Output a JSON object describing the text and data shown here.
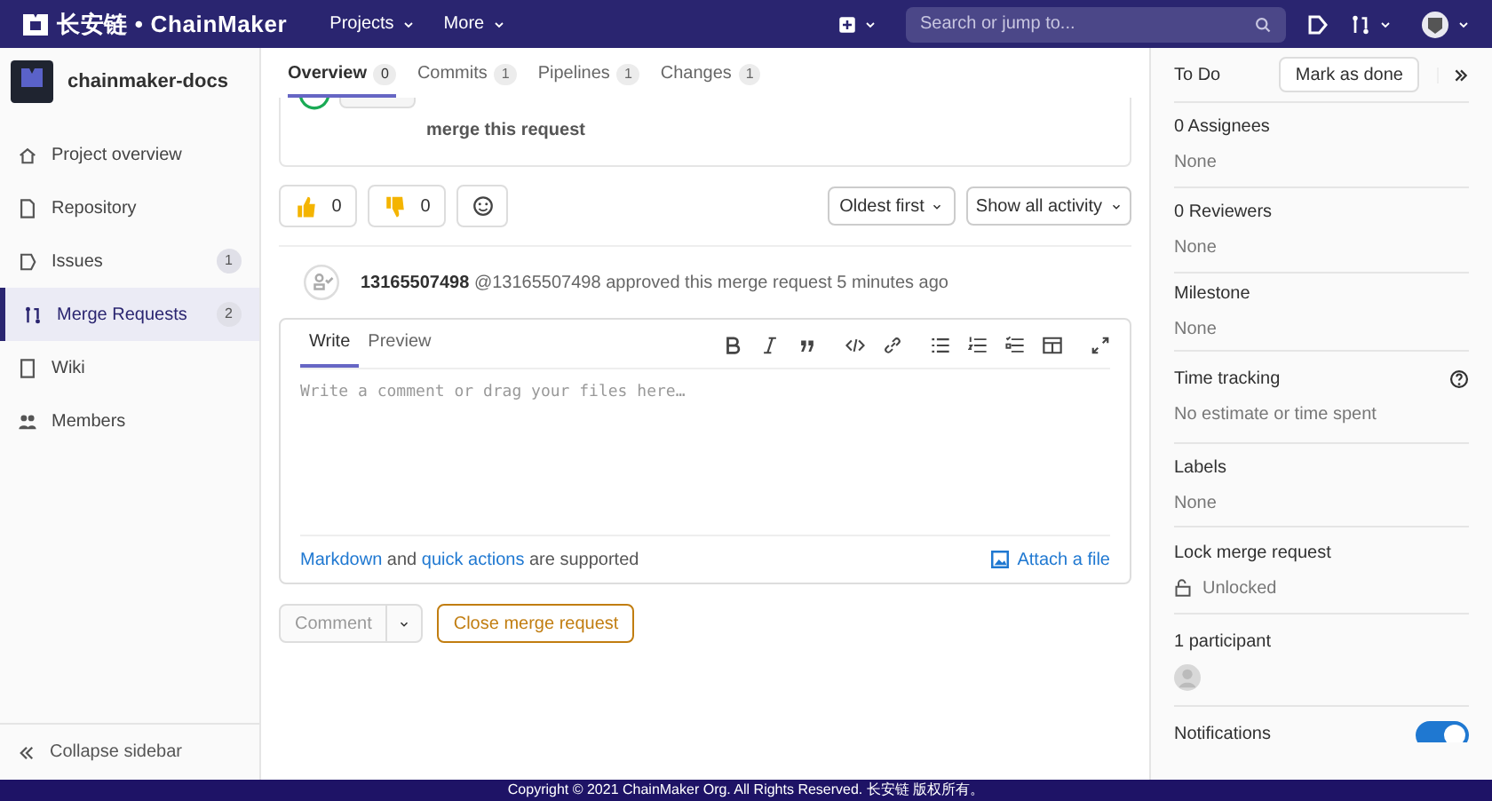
{
  "navbar": {
    "brand": "长安链 • ChainMaker",
    "menus": [
      {
        "label": "Projects"
      },
      {
        "label": "More"
      }
    ],
    "search": {
      "placeholder": "Search or jump to..."
    }
  },
  "sidebar": {
    "project": "chainmaker-docs",
    "items": [
      {
        "label": "Project overview",
        "selected": false
      },
      {
        "label": "Repository",
        "selected": false
      },
      {
        "label": "Issues",
        "count": "1",
        "selected": false
      },
      {
        "label": "Merge Requests",
        "count": "2",
        "selected": true
      },
      {
        "label": "Wiki",
        "selected": false
      },
      {
        "label": "Members",
        "selected": false
      }
    ],
    "collapse": "Collapse sidebar"
  },
  "tabs": [
    {
      "label": "Overview",
      "count": "0",
      "selected": true
    },
    {
      "label": "Commits",
      "count": "1",
      "selected": false
    },
    {
      "label": "Pipelines",
      "count": "1",
      "selected": false
    },
    {
      "label": "Changes",
      "count": "1",
      "selected": false
    }
  ],
  "widget": {
    "text": "merge this request"
  },
  "reactions": [
    {
      "kind": "thumbsup",
      "count": "0"
    },
    {
      "kind": "thumbsdown",
      "count": "0"
    }
  ],
  "sort": "Oldest first",
  "filter": "Show all activity",
  "activity": {
    "author": "13165507498",
    "text": "@13165507498 approved this merge request 5 minutes ago"
  },
  "editor": {
    "tabs": [
      {
        "label": "Write",
        "selected": true
      },
      {
        "label": "Preview",
        "selected": false
      }
    ],
    "placeholder": "Write a comment or drag your files here…",
    "footer": [
      {
        "text": "Markdown",
        "kind": "link"
      },
      {
        "text": " and ",
        "kind": "text"
      },
      {
        "text": "quick actions",
        "kind": "link"
      },
      {
        "text": " are supported",
        "kind": "text"
      }
    ],
    "attach": "Attach a file"
  },
  "actions": {
    "comment": "Comment",
    "close": "Close merge request"
  },
  "right": {
    "todo": "To Do",
    "mark": "Mark as done",
    "sections": [
      {
        "title": "0 Assignees",
        "value": "None"
      },
      {
        "title": "0 Reviewers",
        "value": "None"
      },
      {
        "title": "Milestone",
        "value": "None"
      },
      {
        "title": "Time tracking",
        "value": "No estimate or time spent",
        "kind": "help"
      },
      {
        "title": "Labels",
        "value": "None"
      },
      {
        "title": "Lock merge request",
        "value": "Unlocked",
        "kind": "lock"
      },
      {
        "title": "1 participant",
        "kind": "avatar"
      }
    ],
    "notifications": {
      "label": "Notifications",
      "on": true
    }
  },
  "footer": "Copyright © 2021 ChainMaker Org. All Rights Reserved. 长安链 版权所有。"
}
